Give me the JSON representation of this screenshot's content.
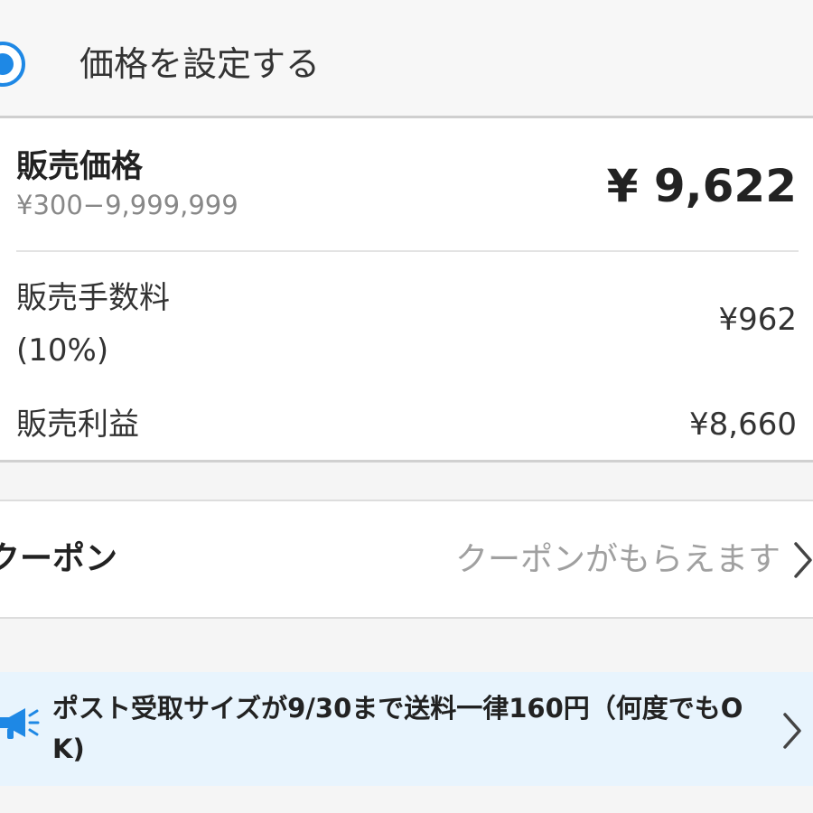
{
  "pricing_mode": {
    "label": "価格を設定する",
    "selected": true,
    "accent_color": "#1e88e5"
  },
  "price_card": {
    "sale_price_label": "販売価格",
    "sale_price_range": "¥300−9,999,999",
    "sale_price_value": "¥ 9,622",
    "fee_label": "販売手数料\n(10%)",
    "fee_value": "¥962",
    "profit_label": "販売利益",
    "profit_value": "¥8,660"
  },
  "coupon": {
    "label": "クーポン",
    "hint": "クーポンがもらえます",
    "chevron_icon": "chevron-right-icon"
  },
  "notice": {
    "icon": "megaphone-icon",
    "text": "ポスト受取サイズが9/30まで送料一律160円（何度でもOK)",
    "chevron_icon": "chevron-right-icon",
    "background_color": "#e8f4fd"
  }
}
